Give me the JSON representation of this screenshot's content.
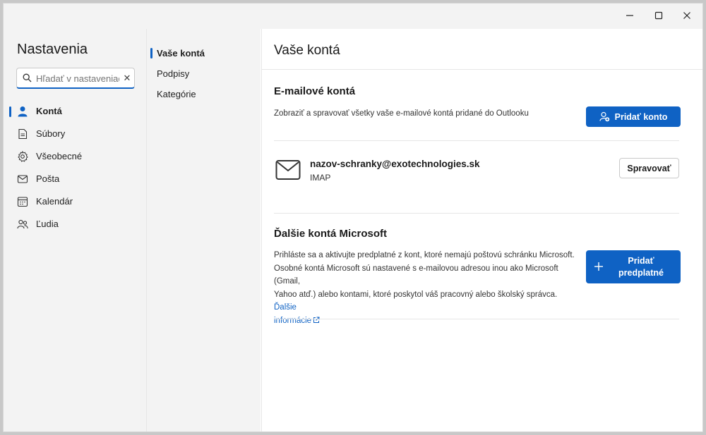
{
  "window": {
    "minimize_icon": "minimize-icon",
    "maximize_icon": "maximize-icon",
    "close_icon": "close-icon"
  },
  "nav": {
    "title": "Nastavenia",
    "search": {
      "placeholder": "Hľadať v nastaveniach",
      "value": ""
    },
    "items": [
      {
        "label": "Kontá",
        "icon": "person-icon",
        "active": true
      },
      {
        "label": "Súbory",
        "icon": "file-icon",
        "active": false
      },
      {
        "label": "Všeobecné",
        "icon": "gear-icon",
        "active": false
      },
      {
        "label": "Pošta",
        "icon": "mail-icon",
        "active": false
      },
      {
        "label": "Kalendár",
        "icon": "calendar-icon",
        "active": false
      },
      {
        "label": "Ľudia",
        "icon": "people-icon",
        "active": false
      }
    ]
  },
  "subnav": {
    "items": [
      {
        "label": "Vaše kontá",
        "active": true
      },
      {
        "label": "Podpisy",
        "active": false
      },
      {
        "label": "Kategórie",
        "active": false
      }
    ]
  },
  "content": {
    "title": "Vaše kontá",
    "email_accounts": {
      "heading": "E-mailové kontá",
      "description": "Zobraziť a spravovať všetky vaše e-mailové kontá pridané do Outlooku",
      "add_button": "Pridať konto",
      "account": {
        "email": "nazov-schranky@exotechnologies.sk",
        "type": "IMAP",
        "manage_button": "Spravovať"
      }
    },
    "microsoft_accounts": {
      "heading": "Ďalšie kontá Microsoft",
      "description_lines": [
        "Prihláste sa a aktivujte predplatné z kont, ktoré nemajú poštovú schránku Microsoft.",
        "Osobné kontá Microsoft sú nastavené s e-mailovou adresou inou ako Microsoft (Gmail,",
        "Yahoo atď.) alebo kontami, ktoré poskytol váš pracovný alebo školský správca."
      ],
      "link_part1": "Ďalšie",
      "link_part2": "informácie",
      "add_button_line1": "Pridať",
      "add_button_line2": "predplatné"
    }
  },
  "colors": {
    "accent": "#0f62c4",
    "nav_bg": "#f3f3f3"
  }
}
